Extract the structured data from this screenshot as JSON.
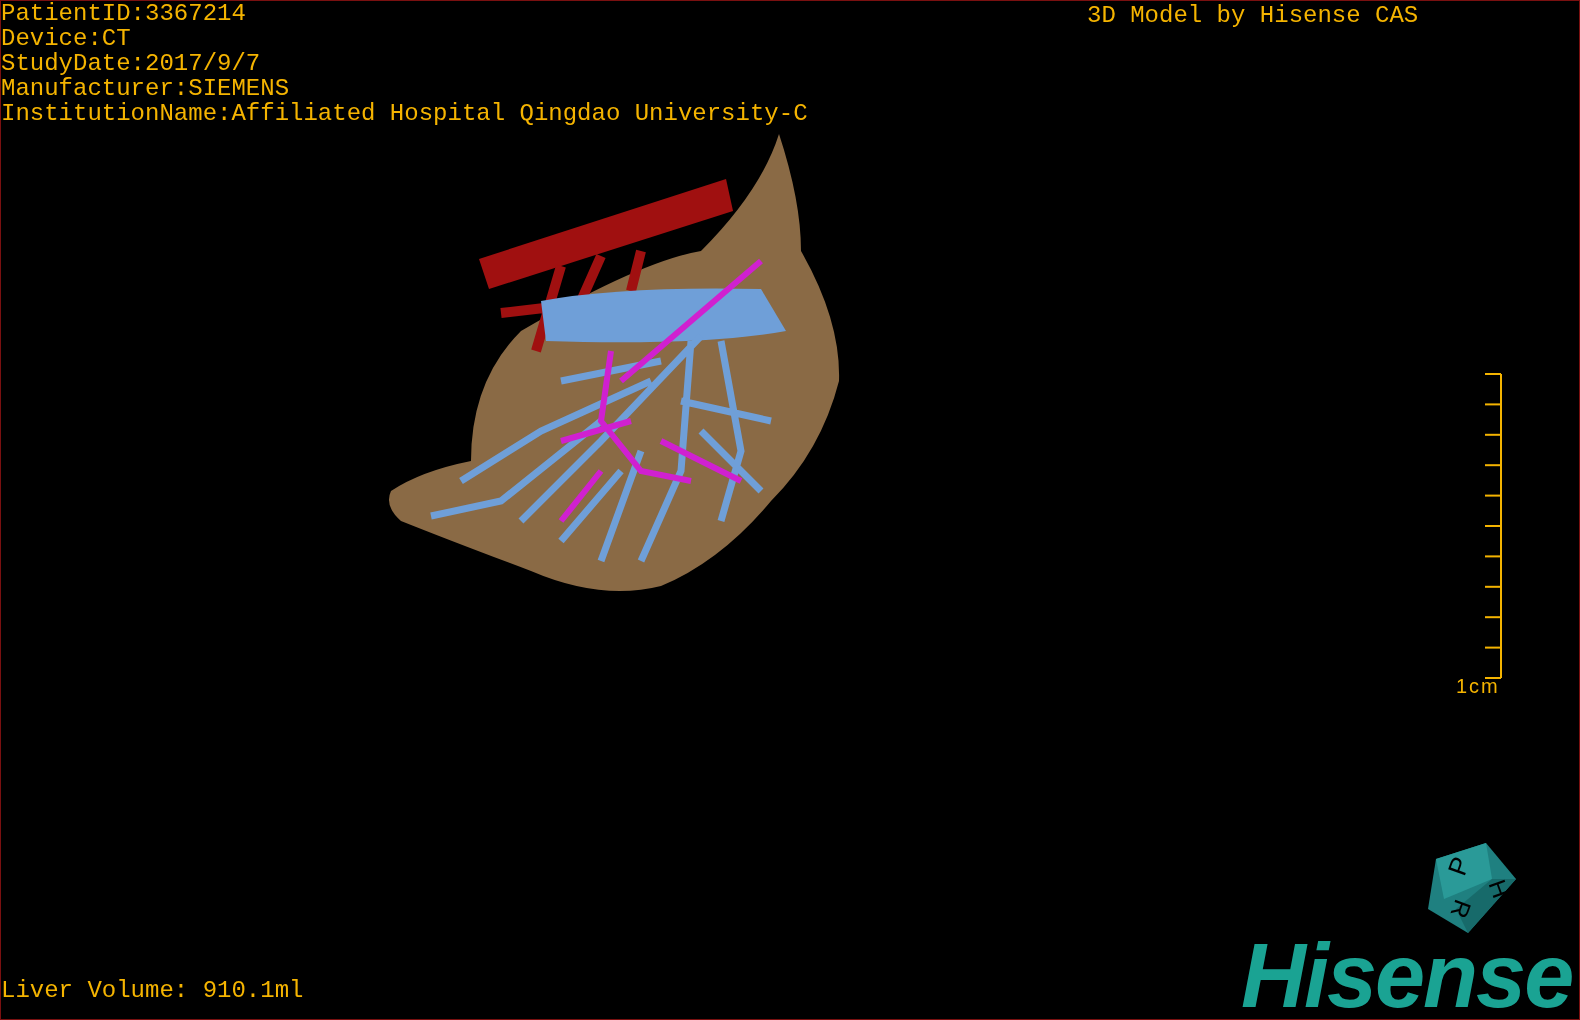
{
  "dicom_info": [
    "PatientID:3367214",
    "Device:CT",
    "StudyDate:2017/9/7",
    "Manufacturer:SIEMENS",
    "InstitutionName:Affiliated Hospital Qingdao University-C"
  ],
  "watermark_title": "3D Model by Hisense CAS",
  "scale_bar": {
    "label": "1cm"
  },
  "orientation_cube": {
    "faces": [
      "P",
      "H",
      "R"
    ]
  },
  "liver_volume": "Liver Volume: 910.1ml",
  "logo": "Hisense"
}
